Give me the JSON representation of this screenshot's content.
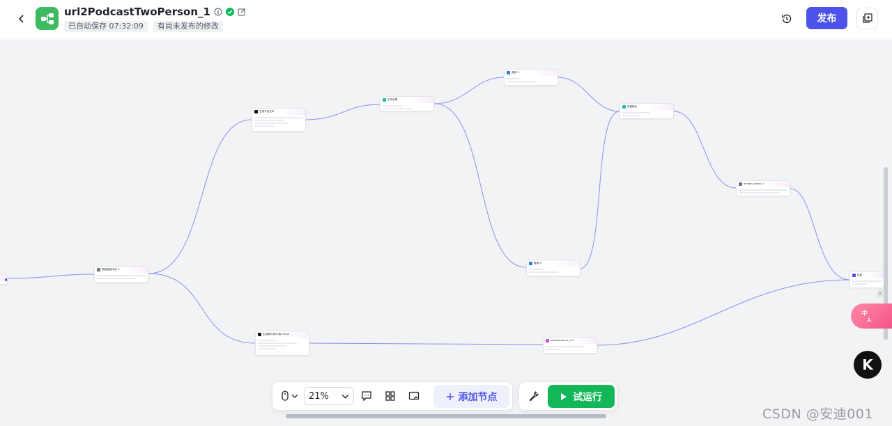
{
  "header": {
    "title": "url2PodcastTwoPerson_1",
    "autosave": "已自动保存 07:32:09",
    "unpublished": "有尚未发布的修改",
    "publish_label": "发布"
  },
  "canvas": {
    "nodes": [
      {
        "key": "n_left",
        "title": ""
      },
      {
        "key": "n_fetch",
        "title": "获取链接内容 ①"
      },
      {
        "key": "n_llm1",
        "title": "生成节目文本"
      },
      {
        "key": "n_text",
        "title": "文本处理"
      },
      {
        "key": "n_tts1",
        "title": "音频 ①"
      },
      {
        "key": "n_merge_var",
        "title": "变量聚合"
      },
      {
        "key": "n_tts2",
        "title": "音频 ①"
      },
      {
        "key": "n_merge_audio",
        "title": "merge_audios ①"
      },
      {
        "key": "n_llm2",
        "title": "生成图片提示词prompt"
      },
      {
        "key": "n_cover",
        "title": "podCastCover_1 ②"
      },
      {
        "key": "n_end",
        "title": "结束"
      }
    ]
  },
  "toolbar": {
    "zoom": "21%",
    "add_node_label": "添加节点",
    "run_label": "试运行"
  },
  "overlays": {
    "watermark": "CSDN @安迪001",
    "k_label": "K"
  },
  "colors": {
    "accent": "#4d53e8",
    "run_green": "#12b857",
    "logo_green": "#3bba5f",
    "edge": "#8c8ff0"
  }
}
